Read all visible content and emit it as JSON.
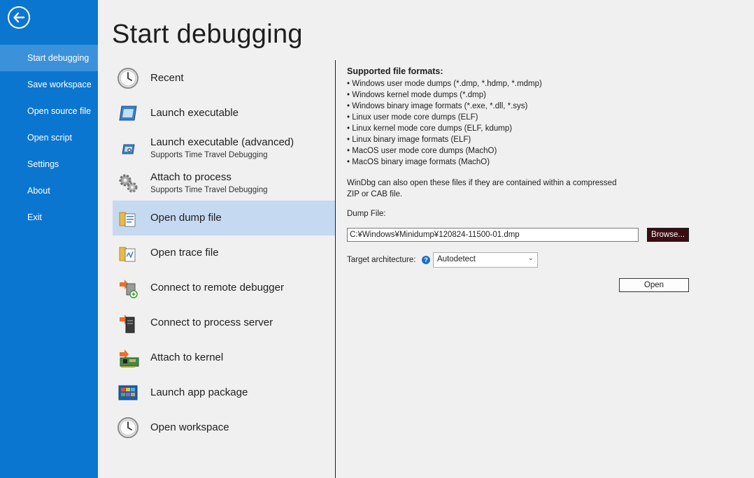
{
  "sidebar": {
    "back_icon": "back-arrow-icon",
    "items": [
      {
        "label": "Start debugging",
        "active": true
      },
      {
        "label": "Save workspace"
      },
      {
        "label": "Open source file"
      },
      {
        "label": "Open script"
      },
      {
        "label": "Settings"
      },
      {
        "label": "About"
      },
      {
        "label": "Exit"
      }
    ],
    "colors": {
      "background": "#0b76d0",
      "active": "#3b92da"
    }
  },
  "page_title": "Start debugging",
  "menu": {
    "items": [
      {
        "label": "Recent",
        "icon": "clock-icon"
      },
      {
        "label": "Launch executable",
        "icon": "executable-window-icon"
      },
      {
        "label": "Launch executable (advanced)",
        "sub": "Supports Time Travel Debugging",
        "icon": "executable-gear-icon"
      },
      {
        "label": "Attach to process",
        "sub": "Supports Time Travel Debugging",
        "icon": "gears-icon"
      },
      {
        "label": "Open dump file",
        "icon": "dump-file-icon",
        "selected": true
      },
      {
        "label": "Open trace file",
        "icon": "trace-file-icon"
      },
      {
        "label": "Connect to remote debugger",
        "icon": "remote-debugger-icon"
      },
      {
        "label": "Connect to process server",
        "icon": "process-server-icon"
      },
      {
        "label": "Attach to kernel",
        "icon": "kernel-board-icon"
      },
      {
        "label": "Launch app package",
        "icon": "app-package-icon"
      },
      {
        "label": "Open workspace",
        "icon": "clock-icon"
      }
    ],
    "selected_color": "#c5d9f1"
  },
  "details": {
    "heading": "Supported file formats:",
    "formats": [
      "• Windows user mode dumps (*.dmp, *.hdmp, *.mdmp)",
      "• Windows kernel mode dumps (*.dmp)",
      "• Windows binary image formats (*.exe, *.dll, *.sys)",
      "• Linux user mode core dumps (ELF)",
      "• Linux kernel mode core dumps (ELF, kdump)",
      "• Linux binary image formats (ELF)",
      "• MacOS user mode core dumps (MachO)",
      "• MacOS binary image formats (MachO)"
    ],
    "note_line1": "WinDbg can also open these files if they are contained within a compressed",
    "note_line2": "ZIP or CAB file.",
    "dump_file_label": "Dump File:",
    "dump_file_value": "C:¥Windows¥Minidump¥120824-11500-01.dmp",
    "browse_label": "Browse...",
    "target_arch_label": "Target architecture:",
    "help_icon": "help-icon",
    "target_arch_value": "Autodetect",
    "open_label": "Open"
  }
}
